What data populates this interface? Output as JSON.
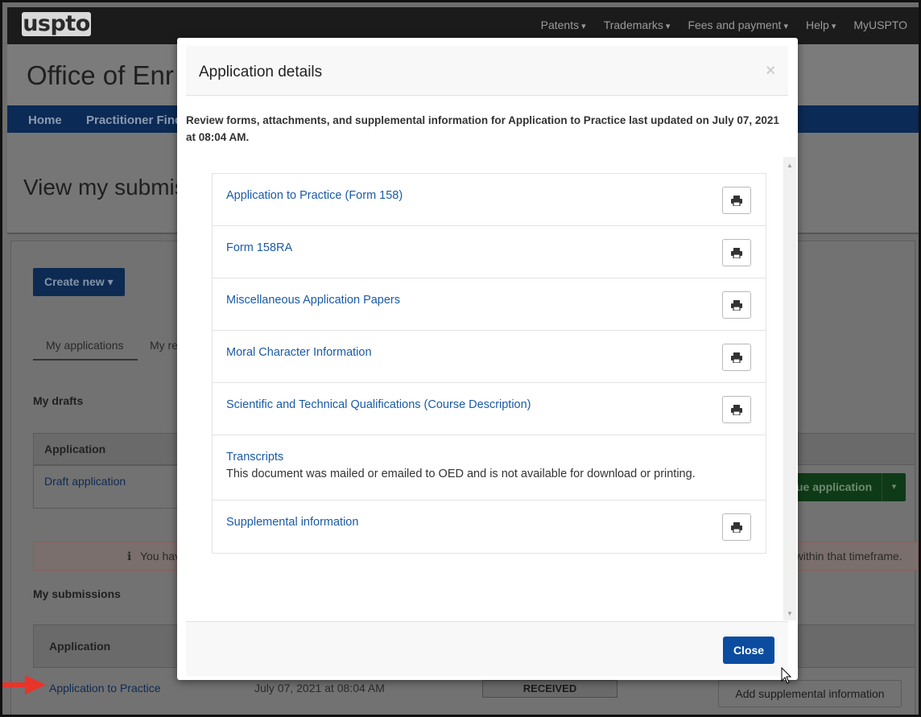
{
  "header": {
    "logo": "uspto",
    "nav": [
      "Patents",
      "Trademarks",
      "Fees and payment",
      "Help",
      "MyUSPTO"
    ]
  },
  "banner": {
    "title_partial": "Office of Enr"
  },
  "bluenav": {
    "home": "Home",
    "finder_partial": "Practitioner Find"
  },
  "page": {
    "title_partial": "View my submis",
    "create_new": "Create new",
    "tabs": [
      "My applications",
      "My re"
    ],
    "drafts_label": "My drafts",
    "application_header": "Application",
    "draft_link": "Draft application",
    "continue_partial": "ue application",
    "alert_left": "You hav",
    "alert_right": "d within that timeframe.",
    "submissions_label": "My submissions",
    "submission_link": "Application to Practice",
    "submission_date": "July 07, 2021 at 08:04 AM",
    "status": "RECEIVED",
    "add_supplemental": "Add supplemental information"
  },
  "modal": {
    "title": "Application details",
    "close_x": "×",
    "description": "Review forms, attachments, and supplemental information for Application to Practice last updated on July 07, 2021 at 08:04 AM.",
    "documents": [
      {
        "label": "Application to Practice (Form 158)"
      },
      {
        "label": "Form 158RA"
      },
      {
        "label": "Miscellaneous Application Papers"
      },
      {
        "label": "Moral Character Information"
      },
      {
        "label": "Scientific and Technical Qualifications (Course Description)"
      },
      {
        "label": "Transcripts",
        "note": "This document was mailed or emailed to OED and is not available for download or printing."
      },
      {
        "label": "Supplemental information"
      }
    ],
    "close_button": "Close"
  },
  "colors": {
    "accent": "#0b4ca1",
    "link": "#1a5aa6"
  },
  "icons": {
    "print": "printer-icon",
    "arrow": "red-arrow-icon"
  }
}
